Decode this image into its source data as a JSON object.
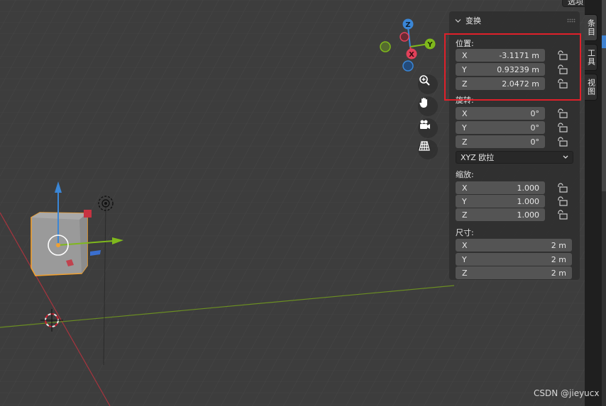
{
  "header": {
    "options_label": "选项"
  },
  "gizmo": {
    "z_label": "Z",
    "y_label": "Y",
    "x_label": "X"
  },
  "nav_tools": [
    "zoom-icon",
    "hand-pan-icon",
    "camera-icon",
    "ortho-grid-icon"
  ],
  "panel": {
    "title": "变换",
    "location": {
      "label": "位置:",
      "rows": [
        {
          "axis": "X",
          "value": "-3.1171 m"
        },
        {
          "axis": "Y",
          "value": "0.93239 m"
        },
        {
          "axis": "Z",
          "value": "2.0472 m"
        }
      ]
    },
    "rotation": {
      "label": "旋转:",
      "rows": [
        {
          "axis": "X",
          "value": "0°"
        },
        {
          "axis": "Y",
          "value": "0°"
        },
        {
          "axis": "Z",
          "value": "0°"
        }
      ],
      "mode": "XYZ 欧拉"
    },
    "scale": {
      "label": "缩放:",
      "rows": [
        {
          "axis": "X",
          "value": "1.000"
        },
        {
          "axis": "Y",
          "value": "1.000"
        },
        {
          "axis": "Z",
          "value": "1.000"
        }
      ]
    },
    "dimensions": {
      "label": "尺寸:",
      "rows": [
        {
          "axis": "X",
          "value": "2 m"
        },
        {
          "axis": "Y",
          "value": "2 m"
        },
        {
          "axis": "Z",
          "value": "2 m"
        }
      ]
    }
  },
  "side_tabs": [
    "条目",
    "工具",
    "视图"
  ],
  "watermark": "CSDN @jieyucx",
  "colors": {
    "viewport_bg": "#3d3d3d",
    "axis_x": "#e2415a",
    "axis_y": "#7fb81c",
    "axis_z": "#3a86d6",
    "selection_outline": "#f0a030",
    "highlight_box": "#e0202a"
  }
}
